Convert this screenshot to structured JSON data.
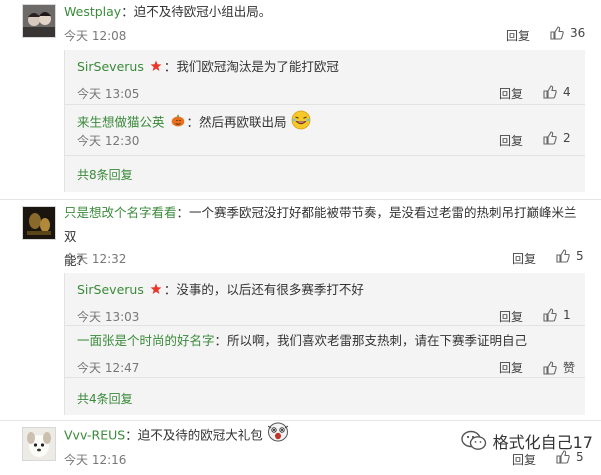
{
  "comments": [
    {
      "user": "Westplay",
      "text": "：迫不及待欧冠小组出局。",
      "time": "今天 12:08",
      "reply": "回复",
      "likes": "36",
      "replies": [
        {
          "user": "SirSeverus",
          "badge": "star",
          "text": "：我们欧冠淘汰是为了能打欧冠",
          "time": "今天 13:05",
          "reply": "回复",
          "likes": "4"
        },
        {
          "user": "来生想做猫公英",
          "badge": "pumpkin",
          "text": "：然后再欧联出局",
          "emoji": "laugh",
          "time": "今天 12:30",
          "reply": "回复",
          "likes": "2"
        }
      ],
      "more": "共8条回复"
    },
    {
      "user": "只是想改个名字看看",
      "text": "：一个赛季欧冠没打好都能被带节奏，是没看过老雷的热刺吊打巅峰米兰双",
      "text2": "能？",
      "time": "今天 12:32",
      "reply": "回复",
      "likes": "5",
      "replies": [
        {
          "user": "SirSeverus",
          "badge": "star",
          "text": "：没事的，以后还有很多赛季打不好",
          "time": "今天 13:03",
          "reply": "回复",
          "likes": "1"
        },
        {
          "user": "一面张是个时尚的好名字",
          "badge": "",
          "text": "：所以啊，我们喜欢老雷那支热刺，请在下赛季证明自己",
          "time": "今天 12:47",
          "reply": "回复",
          "likes": "赞"
        }
      ],
      "more": "共4条回复"
    },
    {
      "user": "Vvv-REUS",
      "text": "：迫不及待的欧冠大礼包",
      "emoji": "shock",
      "time": "今天 12:16",
      "reply": "回复",
      "likes": "5"
    }
  ],
  "watermark": "格式化自己17"
}
